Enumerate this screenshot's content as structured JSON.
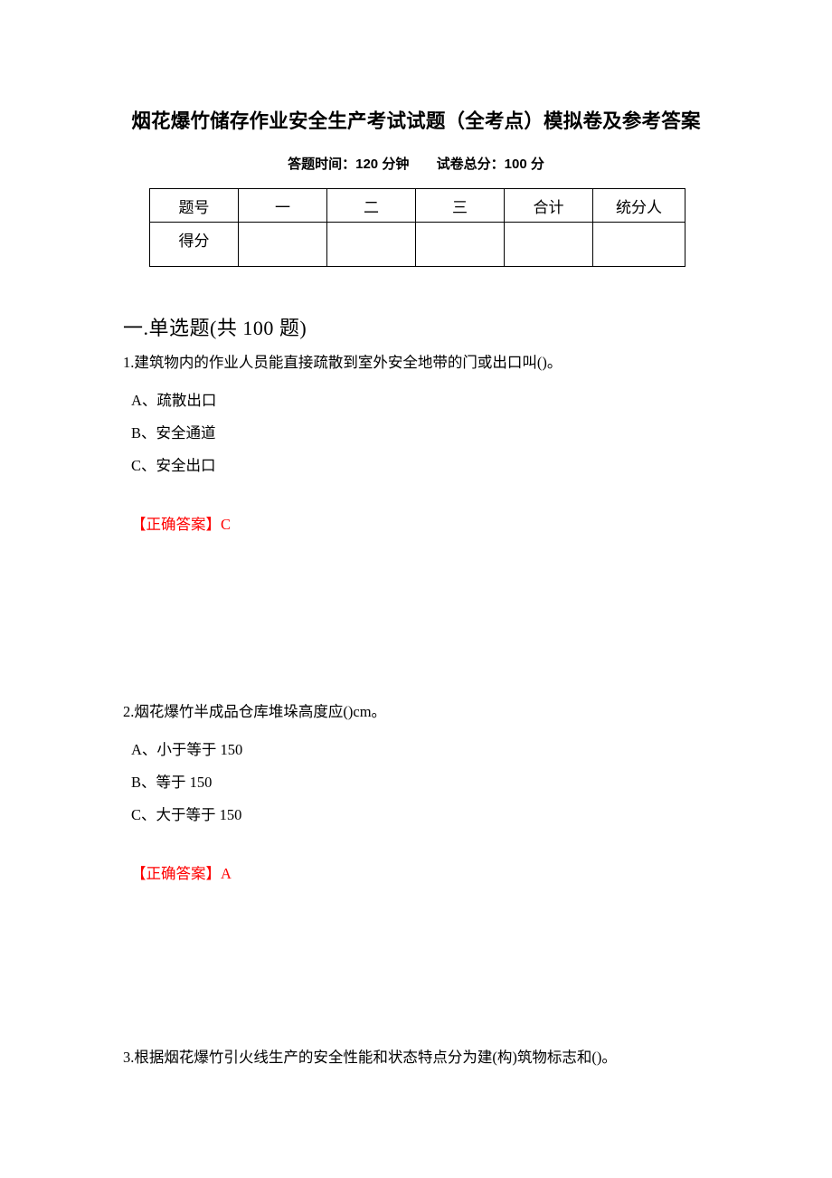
{
  "document": {
    "title": "烟花爆竹储存作业安全生产考试试题（全考点）模拟卷及参考答案",
    "subtitle_time": "答题时间：120 分钟",
    "subtitle_score": "试卷总分：100 分",
    "answer_color": "#ff0000",
    "text_color": "#000000",
    "background_color": "#ffffff"
  },
  "score_table": {
    "row_labels": [
      "题号",
      "得分"
    ],
    "columns": [
      "一",
      "二",
      "三",
      "合计",
      "统分人"
    ],
    "values_row": [
      "",
      "",
      "",
      "",
      ""
    ]
  },
  "section": {
    "heading": "一.单选题(共 100 题)"
  },
  "questions": [
    {
      "stem": "1.建筑物内的作业人员能直接疏散到室外安全地带的门或出口叫()。",
      "options": [
        "A、疏散出口",
        "B、安全通道",
        "C、安全出口"
      ],
      "answer_label": "【正确答案】",
      "answer_value": "C"
    },
    {
      "stem": "2.烟花爆竹半成品仓库堆垛高度应()cm。",
      "options": [
        "A、小于等于 150",
        "B、等于 150",
        "C、大于等于 150"
      ],
      "answer_label": "【正确答案】",
      "answer_value": "A"
    },
    {
      "stem": "3.根据烟花爆竹引火线生产的安全性能和状态特点分为建(构)筑物标志和()。",
      "options": [],
      "answer_label": "",
      "answer_value": ""
    }
  ]
}
